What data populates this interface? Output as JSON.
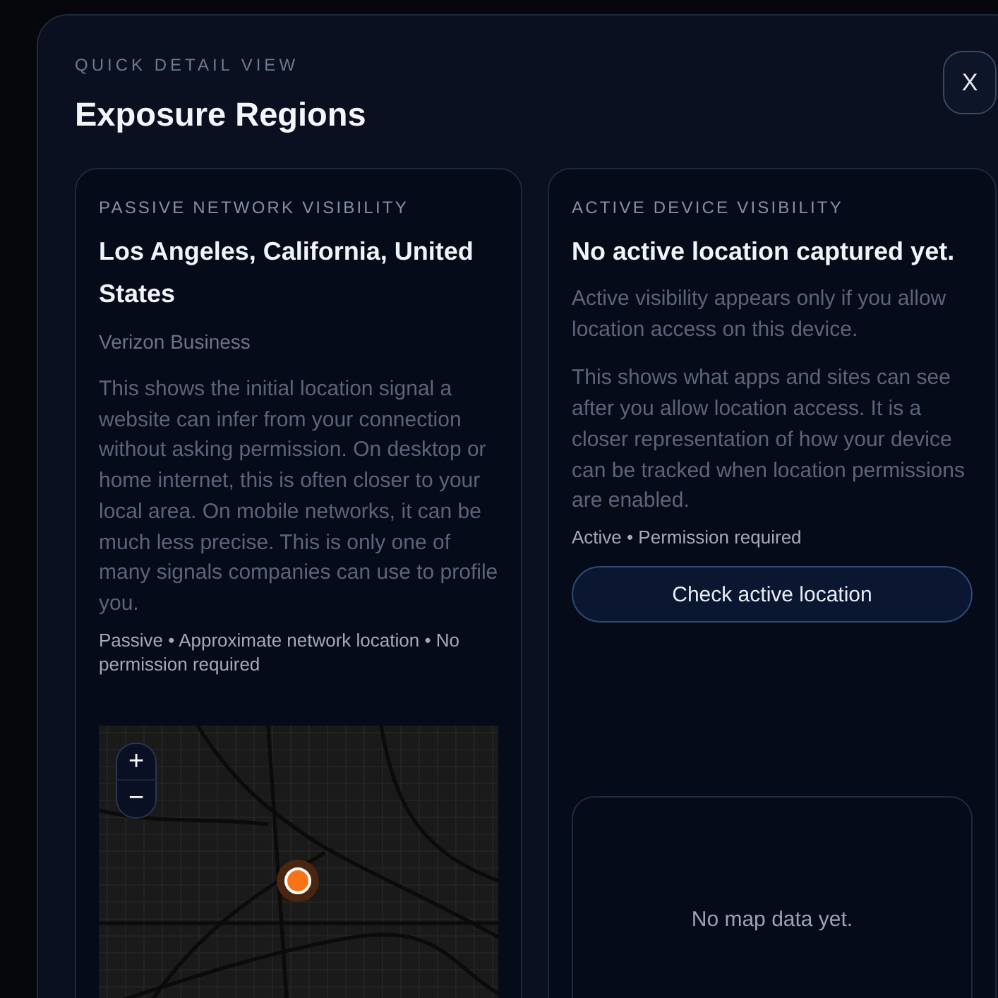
{
  "modal": {
    "eyebrow": "QUICK DETAIL VIEW",
    "title": "Exposure Regions",
    "close_button": "X"
  },
  "panels": [
    {
      "label": "PASSIVE NETWORK VISIBILITY",
      "heading": "Los Angeles, California, United States",
      "provider": "Verizon Business",
      "paragraphs": [
        "This shows the initial location signal a website can infer from your connection without asking permission. On desktop or home internet, this is often closer to your local area. On mobile networks, it can be much less precise. This is only one of many signals companies can use to profile you."
      ],
      "meta": "Passive • Approximate network location • No permission required",
      "map": {
        "kind": "street_map",
        "zoom_in": "+",
        "zoom_out": "−"
      }
    },
    {
      "label": "ACTIVE DEVICE VISIBILITY",
      "heading": "No active location captured yet.",
      "paragraphs": [
        "Active visibility appears only if you allow location access on this device.",
        "This shows what apps and sites can see after you allow location access. It is a closer representation of how your device can be tracked when location permissions are enabled."
      ],
      "meta": "Active • Permission required",
      "button": "Check active location",
      "map": {
        "kind": "empty",
        "message": "No map data yet."
      }
    }
  ]
}
